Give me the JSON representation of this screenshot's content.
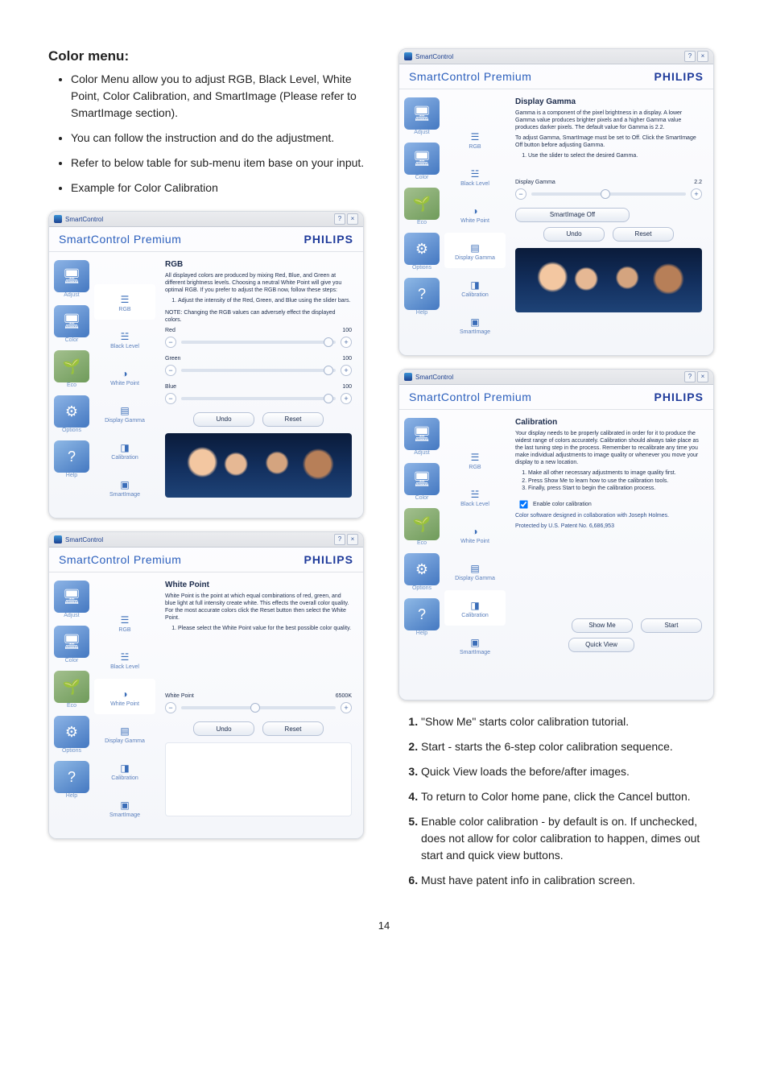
{
  "page": {
    "number": "14",
    "heading": "Color menu:",
    "bullets": [
      "Color Menu allow you to adjust RGB, Black Level, White Point, Color Calibration, and SmartImage (Please refer to SmartImage section).",
      "You can follow the instruction and do the adjustment.",
      "Refer to below table for sub-menu item base on your input.",
      "Example for Color Calibration"
    ],
    "ordered": [
      "\"Show Me\" starts color calibration tutorial.",
      "Start - starts the 6-step color calibration sequence.",
      "Quick View loads the before/after images.",
      "To return to Color home pane, click the Cancel button.",
      "Enable color calibration - by default is on. If unchecked, does not allow for color calibration to happen, dimes out start and quick view buttons.",
      "Must have patent info in calibration screen."
    ]
  },
  "common": {
    "titlebar_app": "SmartControl",
    "help_glyph": "?",
    "close_glyph": "×",
    "product": "SmartControl Premium",
    "brand": "PHILIPS",
    "sidebar": [
      {
        "label": "Adjust",
        "class": "adjust",
        "glyph": "🖥"
      },
      {
        "label": "Color",
        "class": "color",
        "glyph": "🖥"
      },
      {
        "label": "Eco",
        "class": "eco",
        "glyph": "🌱"
      },
      {
        "label": "Options",
        "class": "options",
        "glyph": "⚙"
      },
      {
        "label": "Help",
        "class": "help",
        "glyph": "?"
      }
    ],
    "submenu": [
      {
        "label": "RGB",
        "glyph": "☰"
      },
      {
        "label": "Black Level",
        "glyph": "☱"
      },
      {
        "label": "White Point",
        "glyph": "◑"
      },
      {
        "label": "Display Gamma",
        "glyph": "▤"
      },
      {
        "label": "Calibration",
        "glyph": "◨"
      },
      {
        "label": "SmartImage",
        "glyph": "▣"
      }
    ],
    "btn_undo": "Undo",
    "btn_reset": "Reset"
  },
  "panel_rgb": {
    "title": "RGB",
    "desc": "All displayed colors are produced by mixing Red, Blue, and Green at different brightness levels. Choosing a neutral White Point will give you optimal RGB. If you prefer to adjust the RGB now, follow these steps:",
    "step": "Adjust the intensity of the Red, Green, and Blue using the slider bars.",
    "note": "NOTE: Changing the RGB values can adversely effect the displayed colors.",
    "sliders": [
      {
        "name": "Red",
        "value": "100"
      },
      {
        "name": "Green",
        "value": "100"
      },
      {
        "name": "Blue",
        "value": "100"
      }
    ]
  },
  "panel_wp": {
    "title": "White Point",
    "desc": "White Point is the point at which equal combinations of red, green, and blue light at full intensity create white. This effects the overall color quality. For the most accurate colors click the Reset button then select the White Point.",
    "step": "Please select the White Point value for the best possible color quality.",
    "slider_name": "White Point",
    "slider_value": "6500K"
  },
  "panel_gamma": {
    "title": "Display Gamma",
    "desc": "Gamma is a component of the pixel brightness in a display. A lower Gamma value produces brighter pixels and a higher Gamma value produces darker pixels. The default value for Gamma is 2.2.",
    "desc2": "To adjust Gamma, SmartImage must be set to Off. Click the SmartImage Off button before adjusting Gamma.",
    "step": "Use the slider to select the desired Gamma.",
    "slider_name": "Display Gamma",
    "slider_value": "2.2",
    "btn_si_off": "SmartImage Off"
  },
  "panel_cal": {
    "title": "Calibration",
    "desc": "Your display needs to be properly calibrated in order for it to produce the widest range of colors accurately. Calibration should always take place as the last tuning step in the process. Remember to recalibrate any time you make individual adjustments to image quality or whenever you move your display to a new location.",
    "steps": [
      "Make all other necessary adjustments to image quality first.",
      "Press Show Me to learn how to use the calibration tools.",
      "Finally, press Start to begin the calibration process."
    ],
    "checkbox": "Enable color calibration",
    "credit": "Color software designed in collaboration with Joseph Holmes.",
    "patent": "Protected by U.S. Patent No. 6,686,953",
    "btn_show": "Show Me",
    "btn_start": "Start",
    "btn_quick": "Quick View"
  }
}
